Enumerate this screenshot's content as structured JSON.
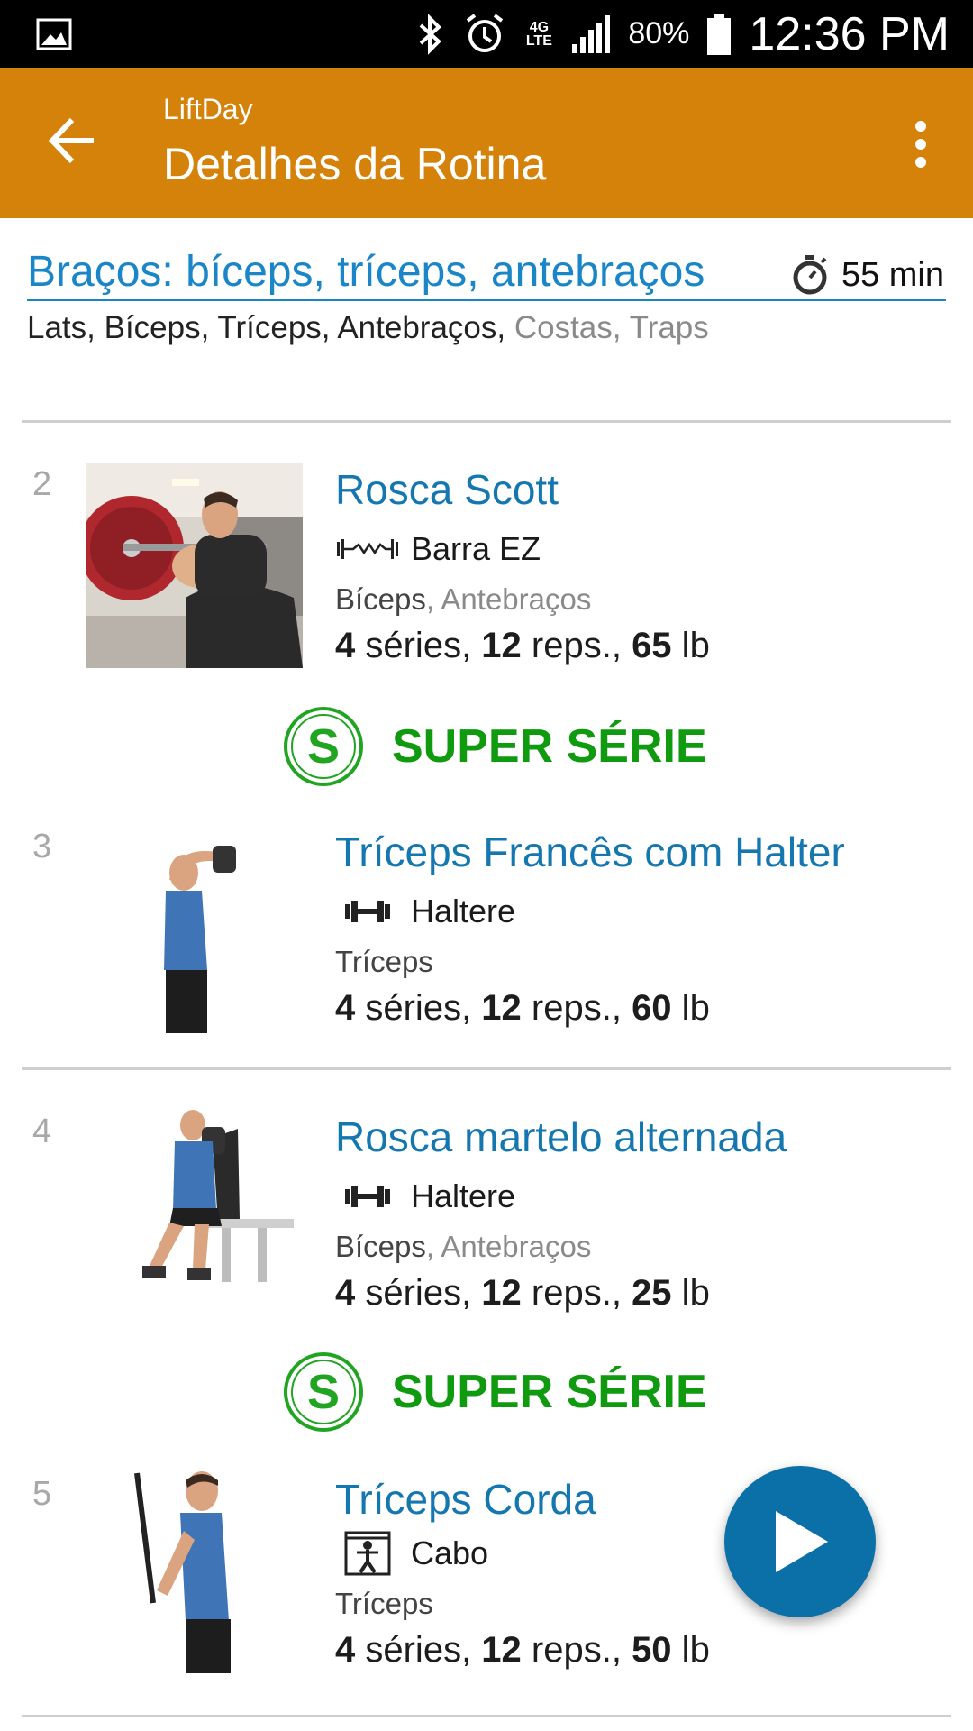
{
  "status_bar": {
    "battery_percent": "80%",
    "time": "12:36 PM",
    "network": "4G LTE"
  },
  "app_bar": {
    "app_name": "LiftDay",
    "title": "Detalhes da Rotina"
  },
  "routine": {
    "title": "Braços: bíceps, tríceps, antebraços",
    "duration": "55 min",
    "primary_muscles": "Lats, Bíceps, Tríceps, Antebraços,",
    "secondary_muscles": " Costas, Traps"
  },
  "exercises": [
    {
      "number": "2",
      "name": "Rosca Scott",
      "equipment": "Barra EZ",
      "equipment_icon": "ez-bar-icon",
      "muscle_primary": "Bíceps",
      "muscle_secondary": ", Antebraços",
      "series": "4",
      "series_label": " séries, ",
      "reps": "12",
      "reps_label": " reps., ",
      "weight": "65",
      "unit": " lb"
    },
    {
      "number": "3",
      "name": "Tríceps Francês com Halter",
      "equipment": "Haltere",
      "equipment_icon": "dumbbell-icon",
      "muscle_primary": "Tríceps",
      "muscle_secondary": "",
      "series": "4",
      "series_label": " séries, ",
      "reps": "12",
      "reps_label": " reps., ",
      "weight": "60",
      "unit": " lb"
    },
    {
      "number": "4",
      "name": "Rosca martelo alternada",
      "equipment": "Haltere",
      "equipment_icon": "dumbbell-icon",
      "muscle_primary": "Bíceps",
      "muscle_secondary": ", Antebraços",
      "series": "4",
      "series_label": " séries, ",
      "reps": "12",
      "reps_label": " reps., ",
      "weight": "25",
      "unit": " lb"
    },
    {
      "number": "5",
      "name": "Tríceps Corda",
      "equipment": "Cabo",
      "equipment_icon": "cable-machine-icon",
      "muscle_primary": "Tríceps",
      "muscle_secondary": "",
      "series": "4",
      "series_label": " séries, ",
      "reps": "12",
      "reps_label": " reps., ",
      "weight": "50",
      "unit": " lb"
    }
  ],
  "superset_label": "SUPER SÉRIE",
  "colors": {
    "app_bar": "#d4820a",
    "link_blue": "#1577b0",
    "superset_green": "#0f9a0f",
    "fab": "#0b6fa8"
  }
}
